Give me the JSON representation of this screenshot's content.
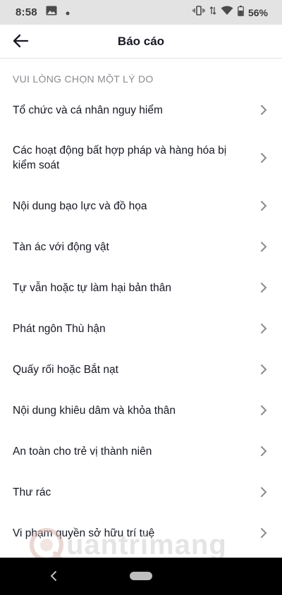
{
  "status_bar": {
    "time": "8:58",
    "battery": "56%",
    "icons": [
      "image-icon",
      "dot-icon",
      "vibrate-icon",
      "data-arrows-icon",
      "wifi-icon",
      "battery-icon"
    ]
  },
  "header": {
    "title": "Báo cáo",
    "back_icon": "arrow-left-icon"
  },
  "section": {
    "heading": "VUI LÒNG CHỌN MỘT LÝ DO"
  },
  "reasons": [
    "Tổ chức và cá nhân nguy hiểm",
    "Các hoạt động bất hợp pháp và hàng hóa bị kiểm soát",
    "Nội dung bạo lực và đồ họa",
    "Tàn ác với động vật",
    "Tự vẫn hoặc tự làm hại bản thân",
    "Phát ngôn Thù hận",
    "Quấy rối hoặc Bắt nạt",
    "Nội dung khiêu dâm và khỏa thân",
    "An toàn cho trẻ vị thành niên",
    "Thư rác",
    "Vi phạm quyền sở hữu trí tuệ"
  ],
  "watermark": {
    "text": "uantrimang"
  },
  "colors": {
    "status_bar": "#e3e3e3",
    "text_primary": "#161823",
    "text_secondary": "#8a8b91",
    "chevron": "#8a8b91",
    "nav_bar": "#000000"
  }
}
